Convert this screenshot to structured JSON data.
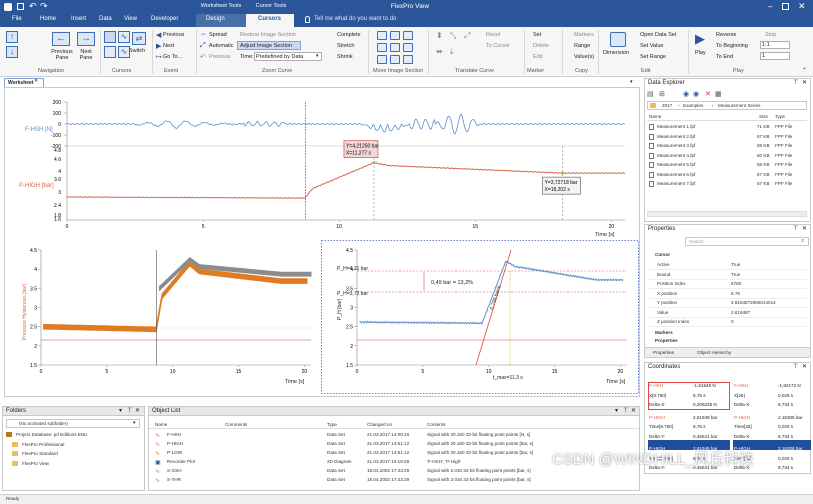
{
  "window": {
    "title": "FlexPro View",
    "context_tabs": [
      "Worksheet Tools",
      "Cursor Tools"
    ]
  },
  "tabs": [
    "File",
    "Home",
    "Insert",
    "Data",
    "View",
    "Developer",
    "Design",
    "Cursors"
  ],
  "tell_me": "Tell me what do you want to do",
  "ribbon": {
    "navigation": {
      "label": "Navigation",
      "prev": "Previous Pane",
      "next": "Next Pane"
    },
    "cursors": {
      "label": "Cursors",
      "switch": "Switch"
    },
    "event": {
      "label": "Event",
      "previous": "Previous",
      "next": "Next",
      "goto": "Go To..."
    },
    "zoom": {
      "label": "Zoom Curve",
      "spread": "Spread",
      "automatic": "Automatic",
      "previous": "Previous",
      "restore": "Restore Image Section",
      "adjust": "Adjust Image Section",
      "time": "Time:",
      "time_value": "Predefined by Data",
      "complete": "Complete",
      "stretch": "Stretch",
      "shrink": "Shrink"
    },
    "move": {
      "label": "Move Image Section"
    },
    "translate": {
      "label": "Translate Curve",
      "reset": "Reset",
      "to_cursor": "To Cursor"
    },
    "marker": {
      "label": "Marker",
      "set": "Set",
      "delete": "Delete",
      "edit": "Edit"
    },
    "copy": {
      "label": "Copy",
      "markers": "Markers",
      "range": "Range",
      "values": "Value(s)"
    },
    "edit": {
      "label": "Edit",
      "dimension": "Dimension",
      "open": "Open Data Set",
      "set_value": "Set Value",
      "set_range": "Set Range"
    },
    "play": {
      "label": "Play",
      "play": "Play",
      "reverse": "Reverse",
      "to_beginning": "To Beginning",
      "to_end": "To End",
      "stop": "Stop",
      "rate": "1:1",
      "step": "1"
    }
  },
  "worksheet": {
    "tab": "Worksheet"
  },
  "chart_top": {
    "type": "line",
    "upper": {
      "ylabel": "F-HSH [N]",
      "yticks": [
        200,
        100,
        0,
        -100,
        -200
      ]
    },
    "lower": {
      "ylabel": "P-HIGH [bar]",
      "yticks": [
        4.8,
        4.6,
        4,
        3.6,
        3,
        2.4,
        1.8,
        1.6
      ]
    },
    "xticks": [
      0,
      5,
      10,
      15,
      20
    ],
    "xlim": [
      0,
      20.5
    ],
    "xlabel": "Time [s]",
    "series": [
      {
        "name": "F-HSH",
        "color": "#5b8fc9"
      },
      {
        "name": "P-HIGH",
        "color": "#d9644a"
      }
    ],
    "cursor1": {
      "x": 8.76,
      "label_line1": "Y=4,21250 bar",
      "label_line2": "X=11,277 s",
      "at_x": 11.277,
      "at_y": 4.2125
    },
    "cursor2": {
      "label_line1": "Y=3,72718 bar",
      "label_line2": "X=18,202 s",
      "at_x": 18.202,
      "at_y": 3.72718
    },
    "marker_left_x": 8.76
  },
  "chart_left": {
    "type": "line",
    "ylabel": "Pressure Hysteresis [bar]",
    "yticks": [
      4.5,
      4,
      3.5,
      3,
      2.5,
      2,
      1.5
    ],
    "xticks": [
      0,
      5,
      10,
      15,
      20
    ],
    "xlim": [
      0,
      20.5
    ],
    "ylim": [
      1.5,
      4.5
    ],
    "xlabel": "Time [s]",
    "series": [
      {
        "name": "",
        "color": "#e07b22"
      },
      {
        "name": "",
        "color": "#8c8c8c"
      }
    ]
  },
  "chart_right": {
    "type": "line",
    "ylabel": "P_H [bar]",
    "yticks": [
      4.5,
      4,
      3.5,
      3,
      2.5,
      2,
      1.5
    ],
    "xticks": [
      0,
      5,
      10,
      15,
      20
    ],
    "xlim": [
      0,
      20.5
    ],
    "ylim": [
      1.5,
      4.5
    ],
    "xlabel": "Time [s]",
    "annotations": {
      "ph_max": "P_H=4,21 bar",
      "ph_min": "P_H=3,72 bar",
      "delta": "0,49 bar = 13,2%",
      "slope": "0,799 bar/s",
      "tmax": "t_max=11,3 s"
    }
  },
  "data_explorer": {
    "title": "Data Explorer",
    "path": [
      "2017",
      "Examples",
      "Measurement Series"
    ],
    "columns": [
      "Name",
      "Size",
      "Type"
    ],
    "files": [
      {
        "name": "Measurement 1.fpf",
        "size": "71 KB",
        "type": "FPF File"
      },
      {
        "name": "Measurement 2.fpf",
        "size": "67 KB",
        "type": "FPF File"
      },
      {
        "name": "Measurement 3.fpf",
        "size": "69 KB",
        "type": "FPF File"
      },
      {
        "name": "Measurement 4.fpf",
        "size": "60 KB",
        "type": "FPF File"
      },
      {
        "name": "Measurement 5.fpf",
        "size": "65 KB",
        "type": "FPF File"
      },
      {
        "name": "Measurement 6.fpf",
        "size": "67 KB",
        "type": "FPF File"
      },
      {
        "name": "Measurement 7.fpf",
        "size": "57 KB",
        "type": "FPF File"
      }
    ]
  },
  "properties": {
    "title": "Properties",
    "search": "Search",
    "section": "Cursor",
    "rows": [
      {
        "name": "Active",
        "value": "True"
      },
      {
        "name": "Bound",
        "value": "True"
      },
      {
        "name": "Position index",
        "value": "8760"
      },
      {
        "name": "X position",
        "value": "8.76"
      },
      {
        "name": "Y position",
        "value": "2.6194872856014014"
      },
      {
        "name": "Value",
        "value": "2.619487"
      },
      {
        "name": "Z position index",
        "value": "0"
      }
    ],
    "collapsed": [
      "Markers",
      "Properties"
    ],
    "bottom_tabs": [
      "Properties",
      "Object Hierarchy"
    ]
  },
  "coordinates": {
    "title": "Coordinates",
    "left": [
      {
        "k": "F-HSH",
        "v": "-1,61549 N"
      },
      {
        "k": "X[8.760]",
        "v": "8,76 s"
      },
      {
        "k": "Delta-X:",
        "v": "0,206235 N"
      },
      {
        "k": "P-HIGH",
        "v": "2,61949 bar"
      },
      {
        "k": "Time[8.760]",
        "v": "8,76 s"
      },
      {
        "k": "Delta-Y:",
        "v": "0,45641 bar"
      },
      {
        "k": "P-HIGH",
        "v": "2,61949 bar"
      },
      {
        "k": "Time[8.760]",
        "v": "8,76 s"
      },
      {
        "k": "Delta-Y:",
        "v": "0,45641 bar"
      }
    ],
    "right": [
      {
        "k": "F-HSH",
        "v": "-1,82172 N"
      },
      {
        "k": "X[26]",
        "v": "0,026 s"
      },
      {
        "k": "Delta-X:",
        "v": "8,734 s"
      },
      {
        "k": "P-HIGH",
        "v": "2,16305 bar"
      },
      {
        "k": "Time[26]",
        "v": "0,026 s"
      },
      {
        "k": "Delta-X:",
        "v": "8,734 s"
      },
      {
        "k": "P-HIGH",
        "v": "2,16308 bar"
      },
      {
        "k": "Time[26]",
        "v": "0,026 s"
      },
      {
        "k": "Delta-X:",
        "v": "8,734 s"
      }
    ]
  },
  "folders": {
    "title": "Folders",
    "combo": "(No activated subfolder)",
    "items": [
      "Project Database: prl Editions ENU",
      "FlexPro Professional",
      "FlexPro Standard",
      "FlexPro View"
    ]
  },
  "object_list": {
    "title": "Object List",
    "columns": [
      "Name",
      "Comments",
      "Type",
      "Changed on",
      "Contents"
    ],
    "rows": [
      {
        "name": "F-HSH",
        "comments": "",
        "type": "Data Set",
        "changed": "21.03.2017 14:09:16",
        "contents": "Signal with 20.160 32-bit floating point points [N, s]"
      },
      {
        "name": "P-HIGH",
        "comments": "",
        "type": "Data Set",
        "changed": "21.03.2017 14:51:12",
        "contents": "Signal with 20.160 32-bit floating point points [bar, s]"
      },
      {
        "name": "P-LOW",
        "comments": "",
        "type": "Data Set",
        "changed": "21.03.2017 14:51:12",
        "contents": "Signal with 20.160 32-bit floating point points [bar, s]"
      },
      {
        "name": "Recorder Plot",
        "comments": "",
        "type": "2D Diagram",
        "changed": "21.03.2017 10:19:28",
        "contents": "'F-HSH', 'P-High'"
      },
      {
        "name": "S-GSH",
        "comments": "",
        "type": "Data Set",
        "changed": "18.04.2002 17:43:29",
        "contents": "Signal with 2.016 32-bit floating point points [bar, s]"
      },
      {
        "name": "S-THR",
        "comments": "",
        "type": "Data Set",
        "changed": "18.04.2002 17:43:29",
        "contents": "Signal with 2.016 32-bit floating point points [bar, s]"
      }
    ]
  },
  "status": {
    "text": "Ready"
  },
  "watermark": "CSDN @WINDHILL_风丘科技",
  "colors": {
    "accent": "#2b579a",
    "cursor_red": "#e04646",
    "line_blue": "#5b8fc9",
    "line_red": "#d9644a",
    "orange": "#e07b22"
  }
}
